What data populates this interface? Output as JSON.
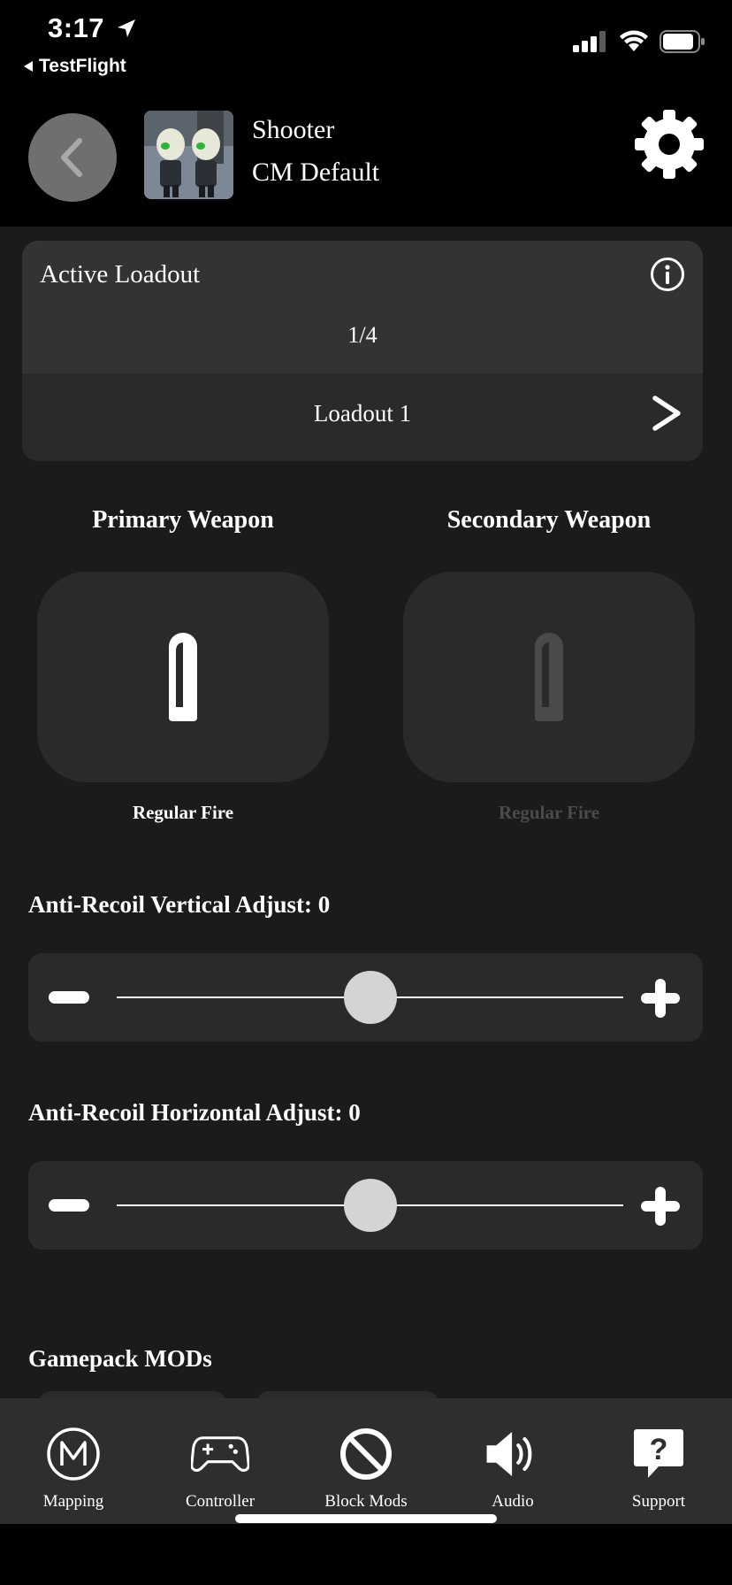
{
  "status_bar": {
    "time": "3:17",
    "back_app": "TestFlight"
  },
  "header": {
    "title": "Shooter",
    "subtitle": "CM Default"
  },
  "loadout": {
    "label": "Active Loadout",
    "count": "1/4",
    "name": "Loadout 1"
  },
  "weapons": {
    "primary": {
      "title": "Primary Weapon",
      "mode": "Regular Fire",
      "enabled": true
    },
    "secondary": {
      "title": "Secondary Weapon",
      "mode": "Regular Fire",
      "enabled": false
    }
  },
  "adjustments": {
    "vertical": {
      "label": "Anti-Recoil Vertical Adjust: 0",
      "value": 0,
      "min": -100,
      "max": 100
    },
    "horizontal": {
      "label": "Anti-Recoil Horizontal Adjust: 0",
      "value": 0,
      "min": -100,
      "max": 100
    }
  },
  "mods": {
    "label": "Gamepack MODs"
  },
  "tab_bar": {
    "items": [
      {
        "label": "Mapping",
        "icon": "mapping-m-icon"
      },
      {
        "label": "Controller",
        "icon": "gamepad-icon"
      },
      {
        "label": "Block Mods",
        "icon": "block-icon"
      },
      {
        "label": "Audio",
        "icon": "speaker-icon"
      },
      {
        "label": "Support",
        "icon": "help-bubble-icon"
      }
    ]
  },
  "colors": {
    "background": "#1b1b1c",
    "card": "#2a2a2b",
    "header": "#000000",
    "disabled_text": "#4b4b4c"
  }
}
